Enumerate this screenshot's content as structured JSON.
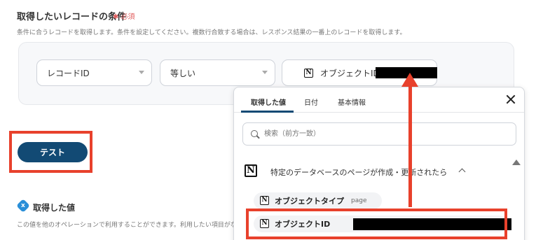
{
  "section": {
    "title": "取得したいレコードの条件",
    "required": "必須",
    "description": "条件に合うレコードを取得します。条件を設定してください。複数行合致する場合は、レスポンス結果の一番上のレコードを取得します。"
  },
  "condition": {
    "field": "レコードID",
    "operator": "等しい",
    "value_label": "オブジェクトID"
  },
  "test_button": "テスト",
  "acquired": {
    "title": "取得した値",
    "description": "この値を他のオペレーションで利用することができます。利用したい項目がな"
  },
  "panel": {
    "tabs": [
      "取得した値",
      "日付",
      "基本情報"
    ],
    "search_placeholder": "検索（前方一致）",
    "trigger": "特定のデータベースのページが作成・更新されたら",
    "items": [
      {
        "label": "オブジェクトタイプ",
        "sub": "page"
      },
      {
        "label": "オブジェクトID"
      }
    ]
  },
  "colors": {
    "accent": "#124a74",
    "highlight": "#e8412c",
    "required": "#e05a5a"
  },
  "icons": {
    "notion": "notion-icon",
    "search": "search-icon",
    "close": "close-icon",
    "chevron": "chevron-up-icon"
  }
}
